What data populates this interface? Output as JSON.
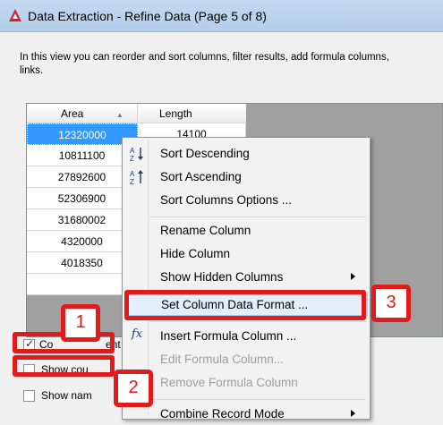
{
  "window": {
    "title": "Data Extraction - Refine Data (Page 5 of 8)",
    "icon": "autocad-icon",
    "accent_color": "#d32027"
  },
  "description": {
    "line1": "In this view you can reorder and sort columns, filter results, add formula columns,",
    "line2": "links."
  },
  "grid": {
    "columns": [
      "Area",
      "Length"
    ],
    "sort_indicator": "▲",
    "rows": [
      {
        "area": "12320000",
        "length": "14100"
      },
      {
        "area": "10811100",
        "length": ""
      },
      {
        "area": "27892600",
        "length": ""
      },
      {
        "area": "52306900",
        "length": ""
      },
      {
        "area": "31680002",
        "length": ""
      },
      {
        "area": "4320000",
        "length": ""
      },
      {
        "area": "4018350",
        "length": ""
      },
      {
        "area": "",
        "length": ""
      }
    ]
  },
  "options": {
    "combine": "Combine identical rows",
    "combine_visible": "Co",
    "combine_tail": "ent",
    "show_count": "Show count column",
    "show_count_visible": "Show cou",
    "show_name": "Show name column",
    "show_name_visible": "Show nam"
  },
  "context_menu": {
    "items": [
      {
        "label": "Sort Descending",
        "icon": "sort-descending-icon",
        "glyph": "A↓Z"
      },
      {
        "label": "Sort Ascending",
        "icon": "sort-ascending-icon",
        "glyph": "A↑Z"
      },
      {
        "label": "Sort Columns Options ..."
      },
      {
        "label": "Rename Column"
      },
      {
        "label": "Hide Column"
      },
      {
        "label": "Show Hidden Columns"
      },
      {
        "label": "Set Column Data Format ..."
      },
      {
        "label": "Insert Formula Column ...",
        "icon": "formula-icon",
        "glyph": "fx"
      },
      {
        "label": "Edit Formula Column..."
      },
      {
        "label": "Remove Formula Column"
      },
      {
        "label": "Combine Record Mode"
      }
    ]
  },
  "callouts": [
    "1",
    "2",
    "3"
  ],
  "callout_color": "#e01b1b"
}
